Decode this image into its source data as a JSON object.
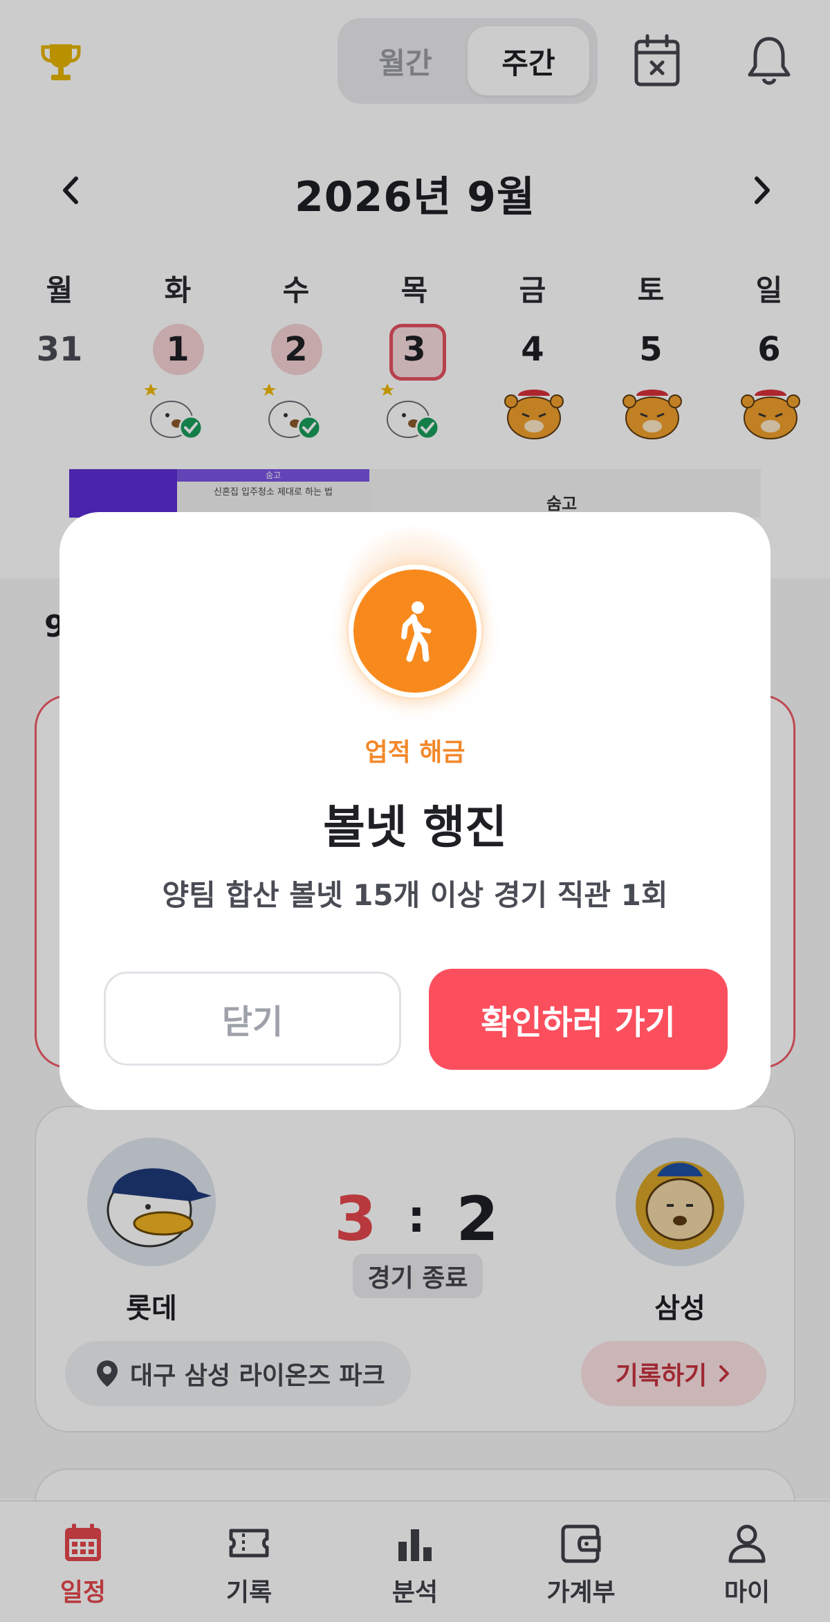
{
  "header": {
    "segment": {
      "monthly_label": "월간",
      "weekly_label": "주간",
      "selected": "주간"
    },
    "month_title": "2026년 9월"
  },
  "week": {
    "weekdays": [
      "월",
      "화",
      "수",
      "목",
      "금",
      "토",
      "일"
    ],
    "days": [
      {
        "num": "31",
        "state": "past",
        "mascot": "none"
      },
      {
        "num": "1",
        "state": "attended",
        "mascot": "seagull-checked-icon"
      },
      {
        "num": "2",
        "state": "attended",
        "mascot": "seagull-checked-icon"
      },
      {
        "num": "3",
        "state": "today",
        "mascot": "seagull-checked-icon"
      },
      {
        "num": "4",
        "state": "upcoming",
        "mascot": "tiger-icon"
      },
      {
        "num": "5",
        "state": "upcoming",
        "mascot": "tiger-icon"
      },
      {
        "num": "6",
        "state": "upcoming",
        "mascot": "tiger-icon"
      }
    ]
  },
  "ad": {
    "inner_bar": "숨고",
    "caption": "신혼집 입주청소 제대로 하는 법",
    "brand": "숨고"
  },
  "section": {
    "date_partial": "9"
  },
  "game": {
    "home_team": "롯데",
    "away_team": "삼성",
    "home_score": "3",
    "separator": ":",
    "away_score": "2",
    "status": "경기 종료",
    "venue": "대구 삼성 라이온즈 파크",
    "record_label": "기록하기"
  },
  "modal": {
    "tag": "업적 해금",
    "title": "볼넷 행진",
    "description": "양팀 합산 볼넷 15개 이상 경기 직관 1회",
    "close_label": "닫기",
    "confirm_label": "확인하러 가기",
    "badge_icon": "walking-person-icon"
  },
  "bottom_nav": [
    {
      "label": "일정",
      "icon": "calendar-icon",
      "active": true
    },
    {
      "label": "기록",
      "icon": "ticket-icon",
      "active": false
    },
    {
      "label": "분석",
      "icon": "bar-chart-icon",
      "active": false
    },
    {
      "label": "가계부",
      "icon": "wallet-icon",
      "active": false
    },
    {
      "label": "마이",
      "icon": "person-icon",
      "active": false
    }
  ],
  "colors": {
    "accent": "#e5484d",
    "achievement": "#f88a1d",
    "confirm": "#fb4f5e",
    "trophy": "#e6b400"
  }
}
